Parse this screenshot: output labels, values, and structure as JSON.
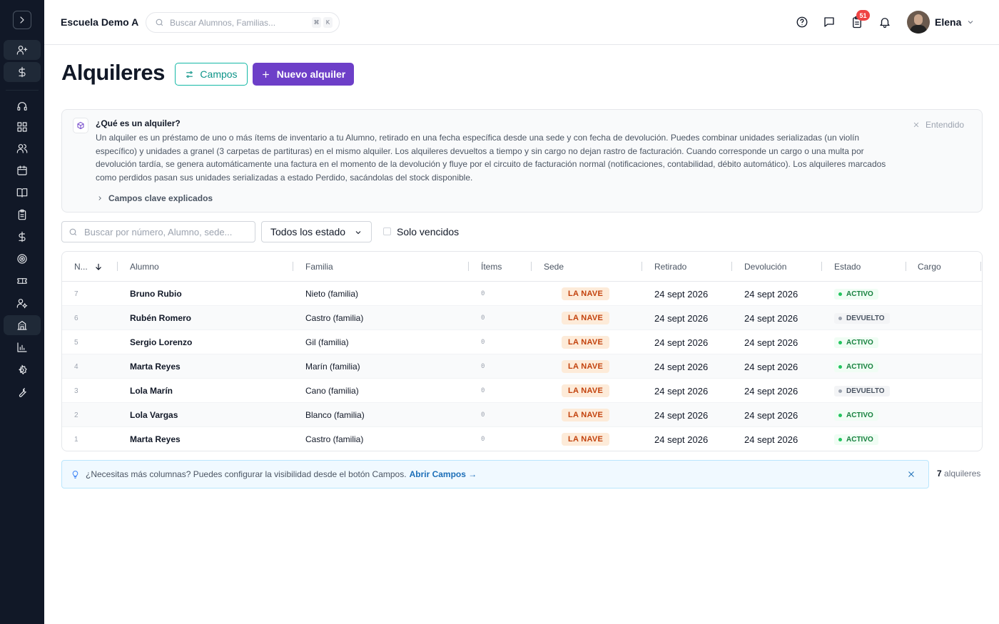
{
  "topbar": {
    "school_name": "Escuela Demo A",
    "search_placeholder": "Buscar Alumnos, Familias...",
    "kbd_1": "⌘",
    "kbd_2": "K",
    "notification_count": "51",
    "user_name": "Elena"
  },
  "sidebar": {
    "icons": [
      "chevron-right-icon",
      "user-plus-icon",
      "dollar-icon",
      "headset-icon",
      "grid-icon",
      "users-icon",
      "calendar-icon",
      "book-icon",
      "clipboard-icon",
      "dollar-icon",
      "target-icon",
      "ticket-icon",
      "user-cog-icon",
      "building-icon",
      "chart-icon",
      "gear-icon",
      "wrench-icon"
    ]
  },
  "header": {
    "title": "Alquileres",
    "campos_label": "Campos",
    "new_label": "Nuevo alquiler"
  },
  "info": {
    "title": "¿Qué es un alquiler?",
    "text": "Un alquiler es un préstamo de uno o más ítems de inventario a tu Alumno, retirado en una fecha específica desde una sede y con fecha de devolución. Puedes combinar unidades serializadas (un violín específico) y unidades a granel (3 carpetas de partituras) en el mismo alquiler. Los alquileres devueltos a tiempo y sin cargo no dejan rastro de facturación. Cuando corresponde un cargo o una multa por devolución tardía, se genera automáticamente una factura en el momento de la devolución y fluye por el circuito de facturación normal (notificaciones, contabilidad, débito automático). Los alquileres marcados como perdidos pasan sus unidades serializadas a estado Perdido, sacándolas del stock disponible.",
    "dismiss_label": "Entendido",
    "expand_label": "Campos clave explicados"
  },
  "filters": {
    "search_placeholder": "Buscar por número, Alumno, sede...",
    "status_value": "Todos los estado",
    "overdue_label": "Solo vencidos"
  },
  "table": {
    "columns": [
      "N...",
      "Alumno",
      "Familia",
      "Ítems",
      "Sede",
      "Retirado",
      "Devolución",
      "Estado",
      "Cargo"
    ],
    "rows": [
      {
        "num": "7",
        "student": "Bruno Rubio",
        "family": "Nieto (familia)",
        "items": "0",
        "sede": "LA NAVE",
        "retirado": "24 sept 2026",
        "devolucion": "24 sept 2026",
        "estado": "ACTIVO",
        "cargo": ""
      },
      {
        "num": "6",
        "student": "Rubén Romero",
        "family": "Castro (familia)",
        "items": "0",
        "sede": "LA NAVE",
        "retirado": "24 sept 2026",
        "devolucion": "24 sept 2026",
        "estado": "DEVUELTO",
        "cargo": ""
      },
      {
        "num": "5",
        "student": "Sergio Lorenzo",
        "family": "Gil (familia)",
        "items": "0",
        "sede": "LA NAVE",
        "retirado": "24 sept 2026",
        "devolucion": "24 sept 2026",
        "estado": "ACTIVO",
        "cargo": ""
      },
      {
        "num": "4",
        "student": "Marta Reyes",
        "family": "Marín (familia)",
        "items": "0",
        "sede": "LA NAVE",
        "retirado": "24 sept 2026",
        "devolucion": "24 sept 2026",
        "estado": "ACTIVO",
        "cargo": ""
      },
      {
        "num": "3",
        "student": "Lola Marín",
        "family": "Cano (familia)",
        "items": "0",
        "sede": "LA NAVE",
        "retirado": "24 sept 2026",
        "devolucion": "24 sept 2026",
        "estado": "DEVUELTO",
        "cargo": ""
      },
      {
        "num": "2",
        "student": "Lola Vargas",
        "family": "Blanco (familia)",
        "items": "0",
        "sede": "LA NAVE",
        "retirado": "24 sept 2026",
        "devolucion": "24 sept 2026",
        "estado": "ACTIVO",
        "cargo": ""
      },
      {
        "num": "1",
        "student": "Marta Reyes",
        "family": "Castro (familia)",
        "items": "0",
        "sede": "LA NAVE",
        "retirado": "24 sept 2026",
        "devolucion": "24 sept 2026",
        "estado": "ACTIVO",
        "cargo": ""
      }
    ]
  },
  "tip": {
    "text": "¿Necesitas más columnas? Puedes configurar la visibilidad desde el botón Campos.",
    "link": "Abrir Campos →"
  },
  "count": {
    "number": "7",
    "label": "alquileres"
  }
}
